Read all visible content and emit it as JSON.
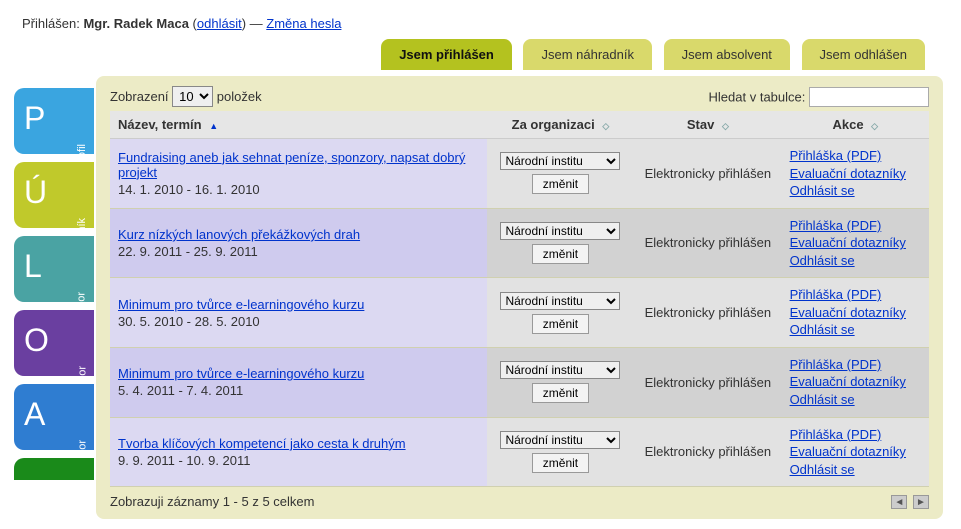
{
  "login": {
    "label": "Přihlášen:",
    "name": "Mgr. Radek Maca",
    "logout": "odhlásit",
    "sep": "—",
    "change_pw": "Změna hesla"
  },
  "tabs": {
    "t0": "Jsem přihlášen",
    "t1": "Jsem náhradník",
    "t2": "Jsem absolvent",
    "t3": "Jsem odhlášen"
  },
  "side": {
    "p": {
      "letter": "P",
      "label": "Profil"
    },
    "u": {
      "letter": "Ú",
      "label": "Účastník"
    },
    "l": {
      "letter": "L",
      "label": "Lektor"
    },
    "o": {
      "letter": "O",
      "label": "Organizátor"
    },
    "a": {
      "letter": "A",
      "label": "Autor"
    }
  },
  "controls": {
    "show_prefix": "Zobrazení",
    "page_size": "10",
    "show_suffix": "položek",
    "search_label": "Hledat v tabulce:"
  },
  "columns": {
    "c0": "Název, termín",
    "c1": "Za organizaci",
    "c2": "Stav",
    "c3": "Akce"
  },
  "common": {
    "org_option": "Národní institu",
    "change_btn": "změnit",
    "status": "Elektronicky přihlášen",
    "a_pdf": "Přihláška (PDF)",
    "a_eval": "Evaluační dotazníky",
    "a_off": "Odhlásit se"
  },
  "rows": [
    {
      "title": "Fundraising aneb jak sehnat peníze, sponzory, napsat dobrý projekt",
      "dates": "14. 1. 2010 - 16. 1. 2010"
    },
    {
      "title": "Kurz nízkých lanových překážkových drah",
      "dates": "22. 9. 2011 - 25. 9. 2011"
    },
    {
      "title": "Minimum pro tvůrce e-learningového kurzu",
      "dates": "30. 5. 2010 - 28. 5. 2010"
    },
    {
      "title": "Minimum pro tvůrce e-learningového kurzu",
      "dates": "5. 4. 2011 - 7. 4. 2011"
    },
    {
      "title": "Tvorba klíčových kompetencí jako cesta k druhým",
      "dates": "9. 9. 2011 - 10. 9. 2011"
    }
  ],
  "footer": {
    "summary": "Zobrazuji záznamy 1 - 5 z 5 celkem"
  }
}
